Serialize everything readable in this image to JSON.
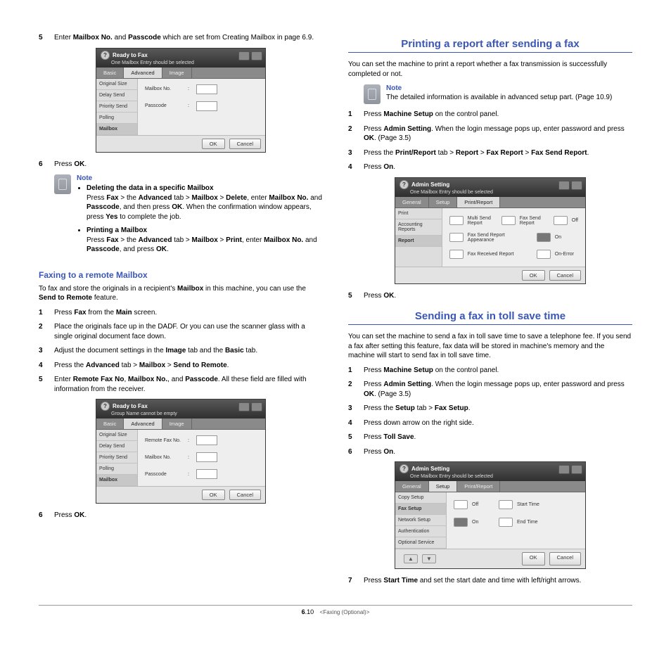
{
  "left": {
    "step5": {
      "n": "5",
      "pre": "Enter ",
      "b1": "Mailbox No.",
      "mid": " and ",
      "b2": "Passcode",
      "post": " which are set from Creating Mailbox in page 6.9."
    },
    "ui1": {
      "title": "Ready to Fax",
      "subtitle": "One Mailbox Entry should be selected",
      "tabs": [
        "Basic",
        "Advanced",
        "Image"
      ],
      "activeTab": 1,
      "side": [
        "Original Size",
        "Delay Send",
        "Priority Send",
        "Polling",
        "Mailbox"
      ],
      "activeSide": 4,
      "fields": [
        {
          "label": "Mailbox No.",
          "sep": ":"
        },
        {
          "label": "Passcode",
          "sep": ":"
        }
      ],
      "ok": "OK",
      "cancel": "Cancel"
    },
    "step6": {
      "n": "6",
      "pre": "Press ",
      "b": "OK",
      "post": "."
    },
    "note1": {
      "label": "Note",
      "bullets": [
        {
          "title": "Deleting the data in a specific Mailbox",
          "line": [
            "Press ",
            "Fax",
            " > the ",
            "Advanced",
            " tab > ",
            "Mailbox",
            " > ",
            "Delete",
            ", enter ",
            "Mailbox No.",
            " and ",
            "Passcode",
            ", and then press ",
            "OK",
            ". When the confirmation window appears, press ",
            "Yes",
            " to complete the job."
          ]
        },
        {
          "title": "Printing a Mailbox",
          "line": [
            "Press ",
            "Fax",
            " > the ",
            "Advanced",
            " tab > ",
            "Mailbox",
            " > ",
            "Print",
            ", enter ",
            "Mailbox No.",
            " and ",
            "Passcode",
            ", and press ",
            "OK",
            "."
          ]
        }
      ]
    },
    "sub1": "Faxing to a remote Mailbox",
    "para1": [
      "To fax and store the originals in a recipient's ",
      "Mailbox",
      " in this machine, you can use the ",
      "Send to Remote",
      " feature."
    ],
    "fsteps": [
      {
        "n": "1",
        "parts": [
          "Press ",
          "Fax",
          " from the ",
          "Main",
          " screen."
        ]
      },
      {
        "n": "2",
        "parts": [
          "Place the originals face up in the DADF. Or you can use the scanner glass with a single original document face down."
        ]
      },
      {
        "n": "3",
        "parts": [
          "Adjust the document settings in the ",
          "Image",
          " tab and the ",
          "Basic",
          " tab."
        ]
      },
      {
        "n": "4",
        "parts": [
          "Press the ",
          "Advanced",
          " tab > ",
          "Mailbox",
          " > ",
          "Send to Remote",
          "."
        ]
      },
      {
        "n": "5",
        "parts": [
          "Enter ",
          "Remote Fax No",
          ", ",
          "Mailbox No.",
          ", and ",
          "Passcode",
          ". All these field are filled with information from the receiver."
        ]
      }
    ],
    "ui2": {
      "title": "Ready to Fax",
      "subtitle": "Group Name cannot be empty",
      "tabs": [
        "Basic",
        "Advanced",
        "Image"
      ],
      "activeTab": 1,
      "side": [
        "Original Size",
        "Delay Send",
        "Priority Send",
        "Polling",
        "Mailbox"
      ],
      "activeSide": 4,
      "fields": [
        {
          "label": "Remote Fax No.",
          "sep": ":"
        },
        {
          "label": "Mailbox No.",
          "sep": ":"
        },
        {
          "label": "Passcode",
          "sep": ":"
        }
      ],
      "ok": "OK",
      "cancel": "Cancel"
    },
    "step6b": {
      "n": "6",
      "pre": "Press ",
      "b": "OK",
      "post": "."
    }
  },
  "right": {
    "h1": "Printing a report after sending a fax",
    "p1": "You can set the machine to print a report whether a fax transmission is successfully completed or not.",
    "note2": {
      "label": "Note",
      "text": "The detailed information is available in advanced setup part. (Page 10.9)"
    },
    "rsteps1": [
      {
        "n": "1",
        "parts": [
          "Press ",
          "Machine Setup",
          " on the control panel."
        ]
      },
      {
        "n": "2",
        "parts": [
          "Press ",
          "Admin Setting",
          ". When the login message pops up, enter password and press ",
          "OK",
          ". (Page 3.5)"
        ]
      },
      {
        "n": "3",
        "parts": [
          "Press the ",
          "Print/Report",
          " tab > ",
          "Report",
          " > ",
          "Fax Report",
          " > ",
          "Fax Send Report",
          "."
        ]
      },
      {
        "n": "4",
        "parts": [
          "Press ",
          "On",
          "."
        ]
      }
    ],
    "ui3": {
      "title": "Admin Setting",
      "subtitle": "One Mailbox Entry should be selected",
      "tabs": [
        "General",
        "Setup",
        "Print/Report"
      ],
      "activeTab": 2,
      "side": [
        "Print",
        "Accounting Reports",
        "Report"
      ],
      "activeSide": 2,
      "rows": [
        [
          {
            "label": "Multi Send Report"
          },
          {
            "label": "Fax Send Report"
          },
          {
            "label": "Off",
            "box": true
          }
        ],
        [
          {
            "label": "Fax Send Report Appearance"
          },
          {
            "label": ""
          },
          {
            "label": "On",
            "box": true,
            "dark": true
          }
        ],
        [
          {
            "label": "Fax Received Report"
          },
          {
            "label": ""
          },
          {
            "label": "On-Error",
            "box": true
          }
        ]
      ],
      "ok": "OK",
      "cancel": "Cancel"
    },
    "step5r": {
      "n": "5",
      "pre": "Press ",
      "b": "OK",
      "post": "."
    },
    "h2": "Sending a fax in toll save time",
    "p2": "You can set the machine to send a fax in toll save time to save a telephone fee. If you send a fax after setting this feature, fax data will be stored in machine's memory and the machine will start to send fax in toll save time.",
    "rsteps2": [
      {
        "n": "1",
        "parts": [
          "Press ",
          "Machine Setup",
          " on the control panel."
        ]
      },
      {
        "n": "2",
        "parts": [
          "Press ",
          "Admin Setting",
          ". When the login message pops up, enter password and press ",
          "OK",
          ". (Page 3.5)"
        ]
      },
      {
        "n": "3",
        "parts": [
          "Press the ",
          "Setup",
          " tab > ",
          "Fax Setup",
          "."
        ]
      },
      {
        "n": "4",
        "parts": [
          "Press down arrow on the right side."
        ]
      },
      {
        "n": "5",
        "parts": [
          "Press ",
          "Toll Save",
          "."
        ]
      },
      {
        "n": "6",
        "parts": [
          "Press ",
          "On",
          "."
        ]
      }
    ],
    "ui4": {
      "title": "Admin Setting",
      "subtitle": "One Mailbox Entry should be selected",
      "tabs": [
        "General",
        "Setup",
        "Print/Report"
      ],
      "activeTab": 1,
      "side": [
        "Copy Setup",
        "Fax Setup",
        "Network Setup",
        "Authentication",
        "Optional Service"
      ],
      "activeSide": 1,
      "rows": [
        [
          {
            "label": "Off",
            "box": true
          },
          {
            "label": "Start Time",
            "box": true
          }
        ],
        [
          {
            "label": "On",
            "box": true,
            "dark": true
          },
          {
            "label": "End Time",
            "box": true
          }
        ]
      ],
      "arrows": [
        "▲",
        "▼"
      ],
      "ok": "OK",
      "cancel": "Cancel"
    },
    "step7": {
      "n": "7",
      "pre": "Press ",
      "b": "Start Time",
      "post": " and set the start date and time with left/right arrows."
    }
  },
  "footer": {
    "page_major": "6",
    "page_minor": ".10",
    "tag": "<Faxing (Optional)>"
  }
}
